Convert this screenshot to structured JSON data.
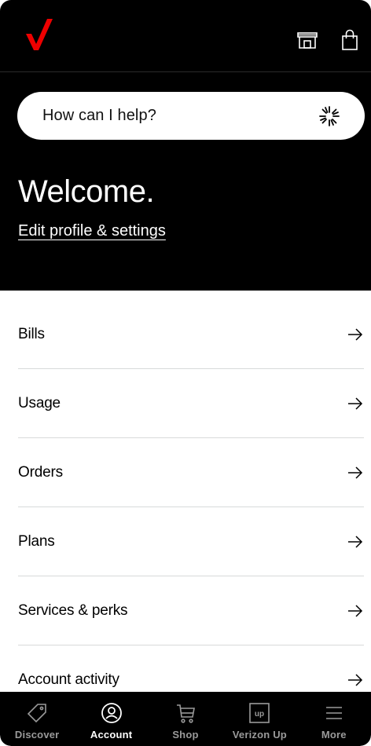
{
  "brand": {
    "accent": "#ee0000",
    "logo_icon": "checkmark-logo-icon"
  },
  "header": {
    "icons": [
      "store-icon",
      "shopping-bag-icon"
    ]
  },
  "search": {
    "placeholder": "How can I help?",
    "icon": "sparkle-icon"
  },
  "hero": {
    "title": "Welcome.",
    "profile_link": "Edit profile & settings"
  },
  "menu": {
    "items": [
      {
        "label": "Bills"
      },
      {
        "label": "Usage"
      },
      {
        "label": "Orders"
      },
      {
        "label": "Plans"
      },
      {
        "label": "Services & perks"
      },
      {
        "label": "Account activity"
      }
    ]
  },
  "nav": {
    "items": [
      {
        "label": "Discover",
        "icon": "tag-icon",
        "active": false
      },
      {
        "label": "Account",
        "icon": "user-circle-icon",
        "active": true
      },
      {
        "label": "Shop",
        "icon": "cart-icon",
        "active": false
      },
      {
        "label": "Verizon Up",
        "icon": "up-badge-icon",
        "badge": "up",
        "active": false
      },
      {
        "label": "More",
        "icon": "menu-icon",
        "active": false
      }
    ]
  }
}
